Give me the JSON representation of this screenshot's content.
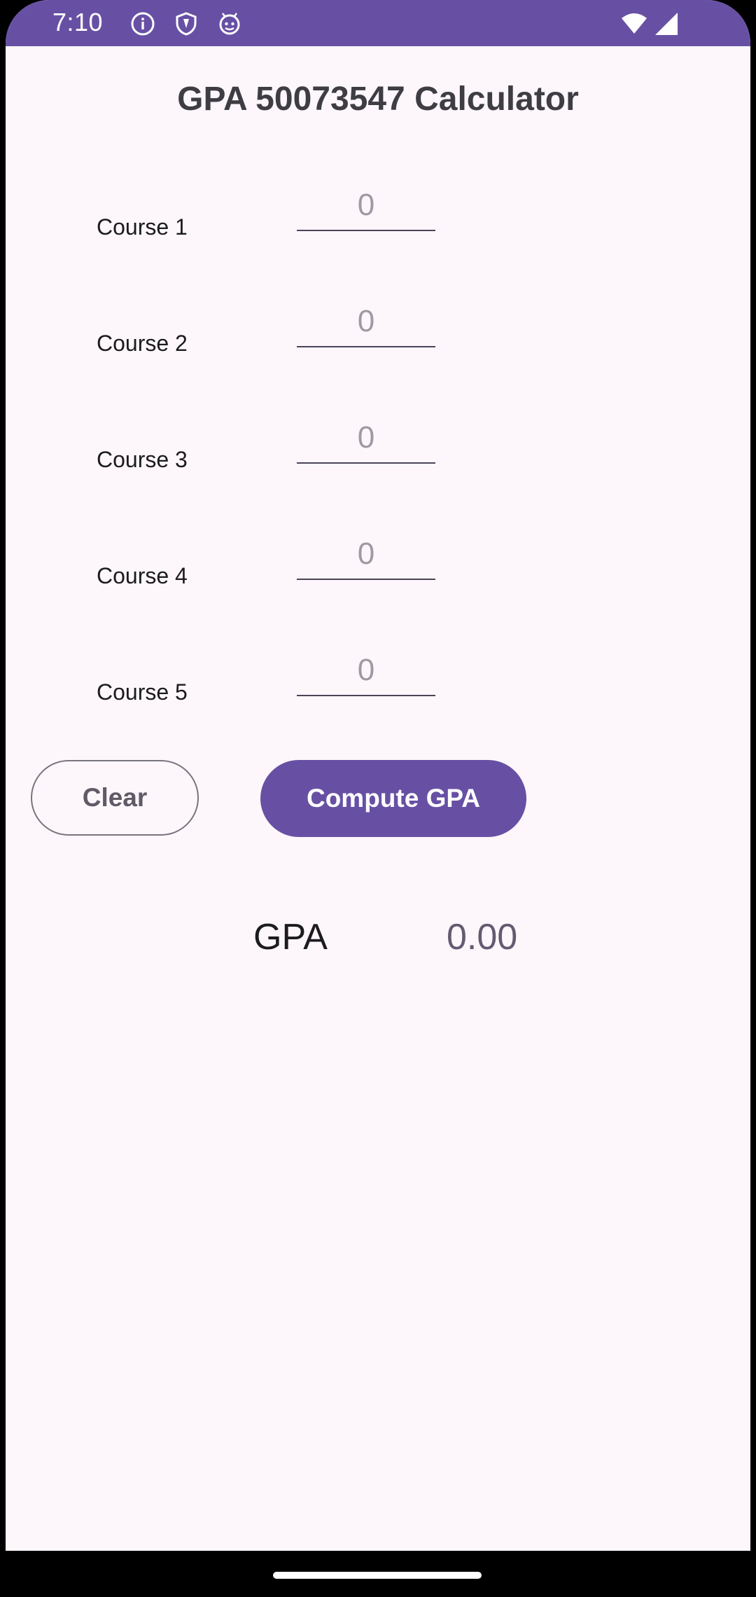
{
  "status_bar": {
    "time": "7:10",
    "icons_left": [
      "info-icon",
      "shield-icon",
      "android-debug-icon"
    ],
    "icons_right": [
      "wifi-icon",
      "cellular-signal-icon"
    ],
    "color": "#6750A4"
  },
  "title": "GPA 50073547 Calculator",
  "courses": [
    {
      "label": "Course 1",
      "value": "",
      "placeholder": "0"
    },
    {
      "label": "Course 2",
      "value": "",
      "placeholder": "0"
    },
    {
      "label": "Course 3",
      "value": "",
      "placeholder": "0"
    },
    {
      "label": "Course 4",
      "value": "",
      "placeholder": "0"
    },
    {
      "label": "Course 5",
      "value": "",
      "placeholder": "0"
    }
  ],
  "buttons": {
    "clear_label": "Clear",
    "compute_label": "Compute GPA"
  },
  "result": {
    "label": "GPA",
    "value": "0.00"
  },
  "colors": {
    "primary": "#6750A4",
    "background": "#FDF7FB",
    "outline": "#79747E"
  }
}
